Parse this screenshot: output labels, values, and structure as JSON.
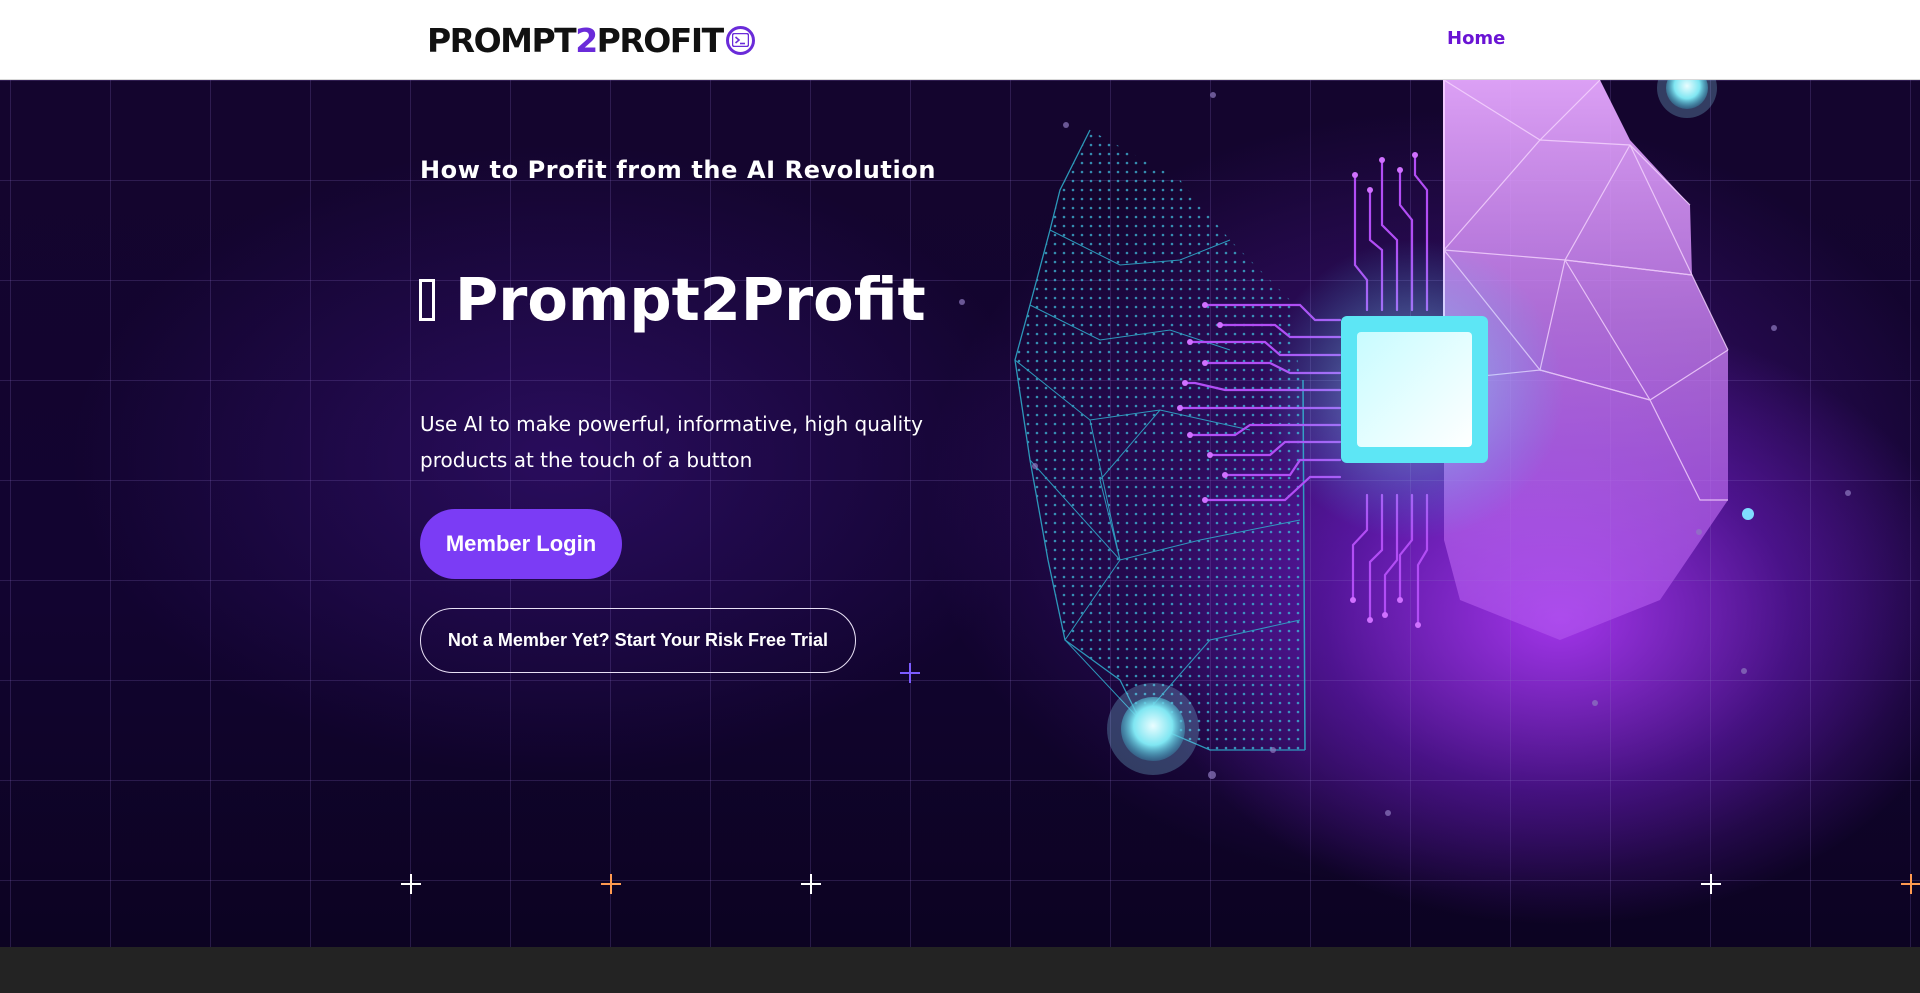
{
  "header": {
    "logo": {
      "part1": "PROMPT",
      "part2": "2",
      "part3": "PROFIT",
      "mark_icon": "terminal-prompt-icon"
    },
    "nav": [
      {
        "label": "Home"
      }
    ]
  },
  "hero": {
    "subtitle": "How to Profit from the AI Revolution",
    "title": "Prompt2Profit",
    "description": "Use AI to make powerful, informative, high quality products at the touch of a button",
    "buttons": {
      "login": "Member Login",
      "trial": "Not a Member Yet? Start Your Risk Free Trial"
    },
    "illustration": "ai-chip-hand-icon"
  },
  "colors": {
    "accent": "#7b3cf5",
    "nav_link": "#6a14d4",
    "hero_background": "#14052e",
    "glow_cyan": "#6ff0ff",
    "glow_magenta": "#c060ff"
  }
}
